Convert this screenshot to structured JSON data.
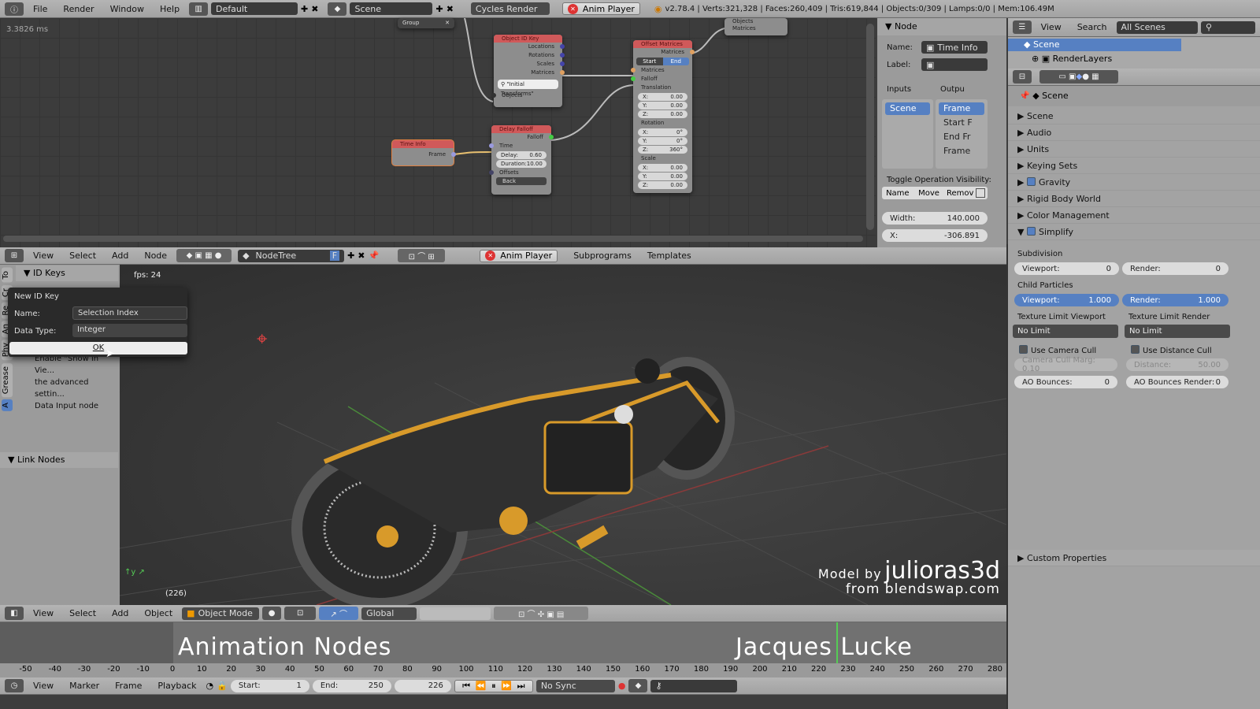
{
  "topbar": {
    "menus": [
      "File",
      "Render",
      "Window",
      "Help"
    ],
    "layout": "Default",
    "scene": "Scene",
    "engine": "Cycles Render",
    "anim_player": "Anim Player",
    "stats": "v2.78.4 | Verts:321,328 | Faces:260,409 | Tris:619,844 | Objects:0/309 | Lamps:0/0 | Mem:106.49M"
  },
  "node_editor": {
    "timing": "3.3826 ms",
    "nodes": {
      "group": {
        "title": "Group"
      },
      "object_id_key": {
        "title": "Object ID Key",
        "outputs": [
          "Locations",
          "Rotations",
          "Scales",
          "Matrices"
        ],
        "search": "\"Initial Transforms\"",
        "input": "Objects"
      },
      "time_info": {
        "title": "Time Info",
        "output": "Frame"
      },
      "delay_falloff": {
        "title": "Delay Falloff",
        "output": "Falloff",
        "time": "Time",
        "delay_label": "Delay:",
        "delay": "0.60",
        "duration_label": "Duration:",
        "duration": "10.00",
        "offsets": "Offsets",
        "mode": "Back"
      },
      "offset_matrices": {
        "title": "Offset Matrices",
        "output": "Matrices",
        "start": "Start",
        "end": "End",
        "in_matrices": "Matrices",
        "falloff": "Falloff",
        "translation": "Translation",
        "t": [
          "0.00",
          "0.00",
          "0.00"
        ],
        "rotation": "Rotation",
        "r": [
          "0°",
          "0°",
          "360°"
        ],
        "scale": "Scale",
        "s": [
          "0.00",
          "0.00",
          "0.00"
        ],
        "axes": [
          "X:",
          "Y:",
          "Z:"
        ]
      },
      "top_right": {
        "rows": [
          "Objects",
          "Matrices"
        ]
      }
    },
    "n_panel": {
      "header": "Node",
      "name_label": "Name:",
      "name": "Time Info",
      "label_label": "Label:",
      "inputs": "Inputs",
      "outputs": "Outpu",
      "input_items": [
        "Scene"
      ],
      "output_items": [
        "Frame",
        "Start F",
        "End Fr",
        "Frame"
      ],
      "toggle_label": "Toggle Operation Visibility:",
      "toggles": [
        "Name",
        "Move",
        "Remov"
      ],
      "width_label": "Width:",
      "width": "140.000",
      "x_label": "X:",
      "x": "-306.891"
    },
    "header": {
      "menus": [
        "View",
        "Select",
        "Add",
        "Node"
      ],
      "tree": "NodeTree",
      "fake": "F",
      "anim_player": "Anim Player",
      "subprograms": "Subprograms",
      "templates": "Templates"
    }
  },
  "outliner": {
    "menus": [
      "View",
      "Search"
    ],
    "filter": "All Scenes",
    "items": [
      "Scene",
      "RenderLayers"
    ]
  },
  "properties": {
    "context": "Scene",
    "panels": [
      "Scene",
      "Audio",
      "Units",
      "Keying Sets",
      "Gravity",
      "Rigid Body World",
      "Color Management",
      "Simplify"
    ],
    "checked": [
      "Gravity",
      "Simplify"
    ],
    "simplify": {
      "subdivision": "Subdivision",
      "viewport_label": "Viewport:",
      "viewport": "0",
      "render_label": "Render:",
      "render": "0",
      "child_particles": "Child Particles",
      "cp_viewport": "1.000",
      "cp_render": "1.000",
      "tex_vp_label": "Texture Limit Viewport",
      "tex_r_label": "Texture Limit Render",
      "tex_vp": "No Limit",
      "tex_r": "No Limit",
      "camera_cull": "Use Camera Cull",
      "distance_cull": "Use Distance Cull",
      "cull_margin": "Camera Cull Marg: 0.10",
      "distance_label": "Distance:",
      "distance": "50.00",
      "ao_label": "AO Bounces:",
      "ao": "0",
      "ao_render_label": "AO Bounces Render:",
      "ao_render": "0"
    },
    "custom": "Custom Properties"
  },
  "toolshelf": {
    "tabs": [
      "To",
      "Cr",
      "Re",
      "An",
      "Phy",
      "Grease",
      "A"
    ],
    "id_keys": "ID Keys",
    "info_lines": [
      "Enable \"Show in Vie...",
      "the advanced settin...",
      "Data Input node"
    ],
    "link_nodes": "Link Nodes"
  },
  "dialog": {
    "title": "New ID Key",
    "name_label": "Name:",
    "name": "Selection Index",
    "type_label": "Data Type:",
    "type": "Integer",
    "ok": "OK"
  },
  "viewport": {
    "fps": "fps: 24",
    "frame": "(226)",
    "credit_1": "Model by",
    "credit_author": "julioras3d",
    "credit_2": "from blendswap.com",
    "accent": "#d89a2a"
  },
  "view3d_header": {
    "menus": [
      "View",
      "Select",
      "Add",
      "Object"
    ],
    "mode": "Object Mode",
    "orientation": "Global"
  },
  "timeline": {
    "overlay_left": "Animation Nodes",
    "overlay_right": "Jacques Lucke",
    "ticks": [
      -50,
      -40,
      -30,
      -20,
      -10,
      0,
      10,
      20,
      30,
      40,
      50,
      60,
      70,
      80,
      90,
      100,
      110,
      120,
      130,
      140,
      150,
      160,
      170,
      180,
      190,
      200,
      210,
      220,
      230,
      240,
      250,
      260,
      270,
      280
    ],
    "current_frame": 226,
    "header": {
      "menus": [
        "View",
        "Marker",
        "Frame",
        "Playback"
      ],
      "start_label": "Start:",
      "start": "1",
      "end_label": "End:",
      "end": "250",
      "frame": "226",
      "sync": "No Sync"
    }
  }
}
